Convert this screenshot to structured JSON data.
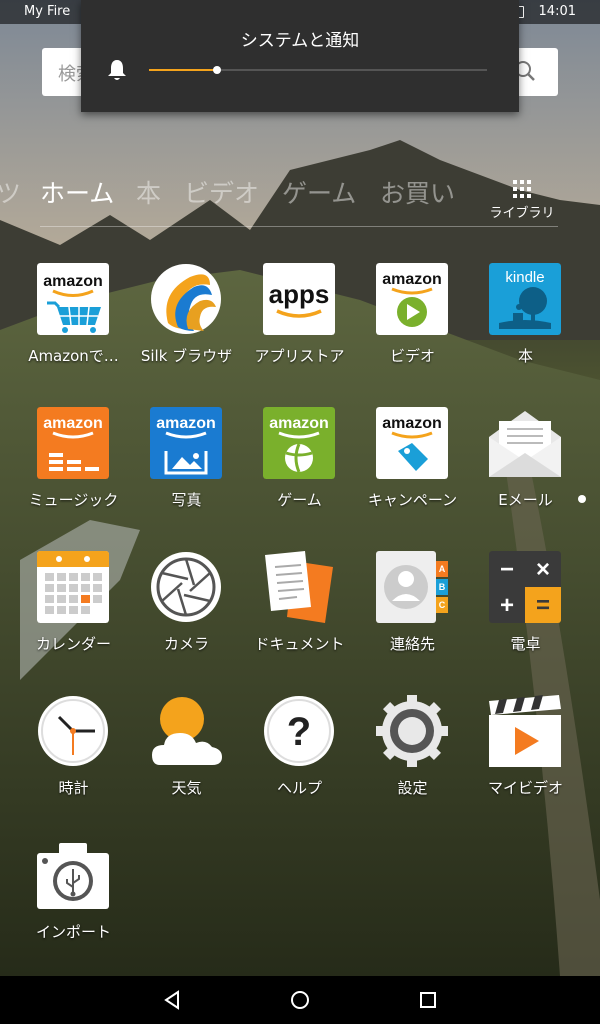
{
  "status_bar": {
    "device_name": "My Fire",
    "time": "14:01"
  },
  "search": {
    "placeholder": "検索"
  },
  "volume_popup": {
    "title": "システムと通知",
    "level": 0.2
  },
  "nav": {
    "items": [
      "ツ",
      "ホーム",
      "本",
      "ビデオ",
      "ゲーム",
      "お買い"
    ],
    "active": "ホーム",
    "library_label": "ライブラリ"
  },
  "apps": [
    {
      "label": "Amazonで…",
      "icon": "amazon-shopping-icon"
    },
    {
      "label": "Silk ブラウザ",
      "icon": "silk-browser-icon"
    },
    {
      "label": "アプリストア",
      "icon": "appstore-icon"
    },
    {
      "label": "ビデオ",
      "icon": "amazon-video-icon"
    },
    {
      "label": "本",
      "icon": "kindle-icon"
    },
    {
      "label": "ミュージック",
      "icon": "amazon-music-icon"
    },
    {
      "label": "写真",
      "icon": "amazon-photos-icon"
    },
    {
      "label": "ゲーム",
      "icon": "amazon-games-icon"
    },
    {
      "label": "キャンペーン",
      "icon": "amazon-campaign-icon"
    },
    {
      "label": "Eメール",
      "icon": "email-icon"
    },
    {
      "label": "カレンダー",
      "icon": "calendar-icon"
    },
    {
      "label": "カメラ",
      "icon": "camera-icon"
    },
    {
      "label": "ドキュメント",
      "icon": "documents-icon"
    },
    {
      "label": "連絡先",
      "icon": "contacts-icon"
    },
    {
      "label": "電卓",
      "icon": "calculator-icon"
    },
    {
      "label": "時計",
      "icon": "clock-icon"
    },
    {
      "label": "天気",
      "icon": "weather-icon"
    },
    {
      "label": "ヘルプ",
      "icon": "help-icon"
    },
    {
      "label": "設定",
      "icon": "settings-icon"
    },
    {
      "label": "マイビデオ",
      "icon": "my-video-icon"
    },
    {
      "label": "インポート",
      "icon": "import-icon"
    }
  ],
  "tile_text": {
    "amazon": "amazon",
    "apps": "apps",
    "kindle": "kindle",
    "help_mark": "?",
    "contacts_tabs": [
      "A",
      "B",
      "C"
    ],
    "calc_keys": [
      "−",
      "×",
      "+",
      "="
    ]
  },
  "colors": {
    "accent": "#f4a31c",
    "music_orange": "#f47b20",
    "photos_blue": "#1a7bd1",
    "games_green": "#7ab02c",
    "kindle_blue": "#1a9fd8"
  },
  "navbar": {
    "icons": [
      "back-icon",
      "home-icon",
      "recents-icon"
    ]
  }
}
